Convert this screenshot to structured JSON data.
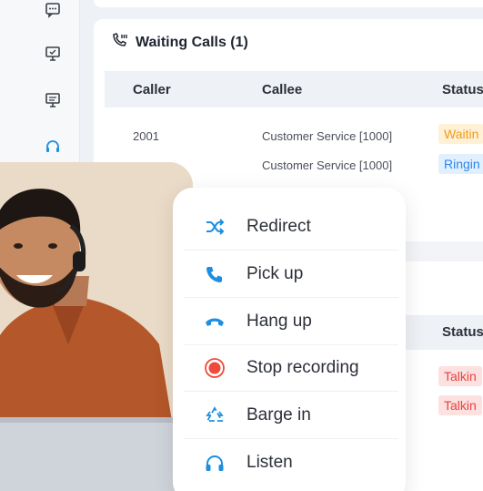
{
  "panel": {
    "title": "Waiting Calls (1)",
    "columns": {
      "caller": "Caller",
      "callee": "Callee",
      "status": "Status"
    },
    "rows": [
      {
        "caller": "2001",
        "callee": "Customer Service [1000]",
        "status": "Waitin"
      },
      {
        "caller": "",
        "callee": "Customer Service [1000]",
        "status": "Ringin"
      }
    ]
  },
  "second_table": {
    "status_header": "Status",
    "rows": [
      {
        "status": "Talkin"
      },
      {
        "status": "Talkin"
      }
    ]
  },
  "menu": {
    "items": [
      {
        "label": "Redirect",
        "icon": "shuffle-icon"
      },
      {
        "label": "Pick up",
        "icon": "phone-icon"
      },
      {
        "label": "Hang up",
        "icon": "hang-up-icon"
      },
      {
        "label": "Stop recording",
        "icon": "record-icon"
      },
      {
        "label": "Barge in",
        "icon": "barge-in-icon"
      },
      {
        "label": "Listen",
        "icon": "headphones-icon"
      }
    ]
  },
  "colors": {
    "accent_blue": "#1e8fe0",
    "record_red": "#ee4b3c",
    "waiting_orange": "#f29a18",
    "ringing_blue": "#2f86e8",
    "talking_red": "#e5443d"
  }
}
